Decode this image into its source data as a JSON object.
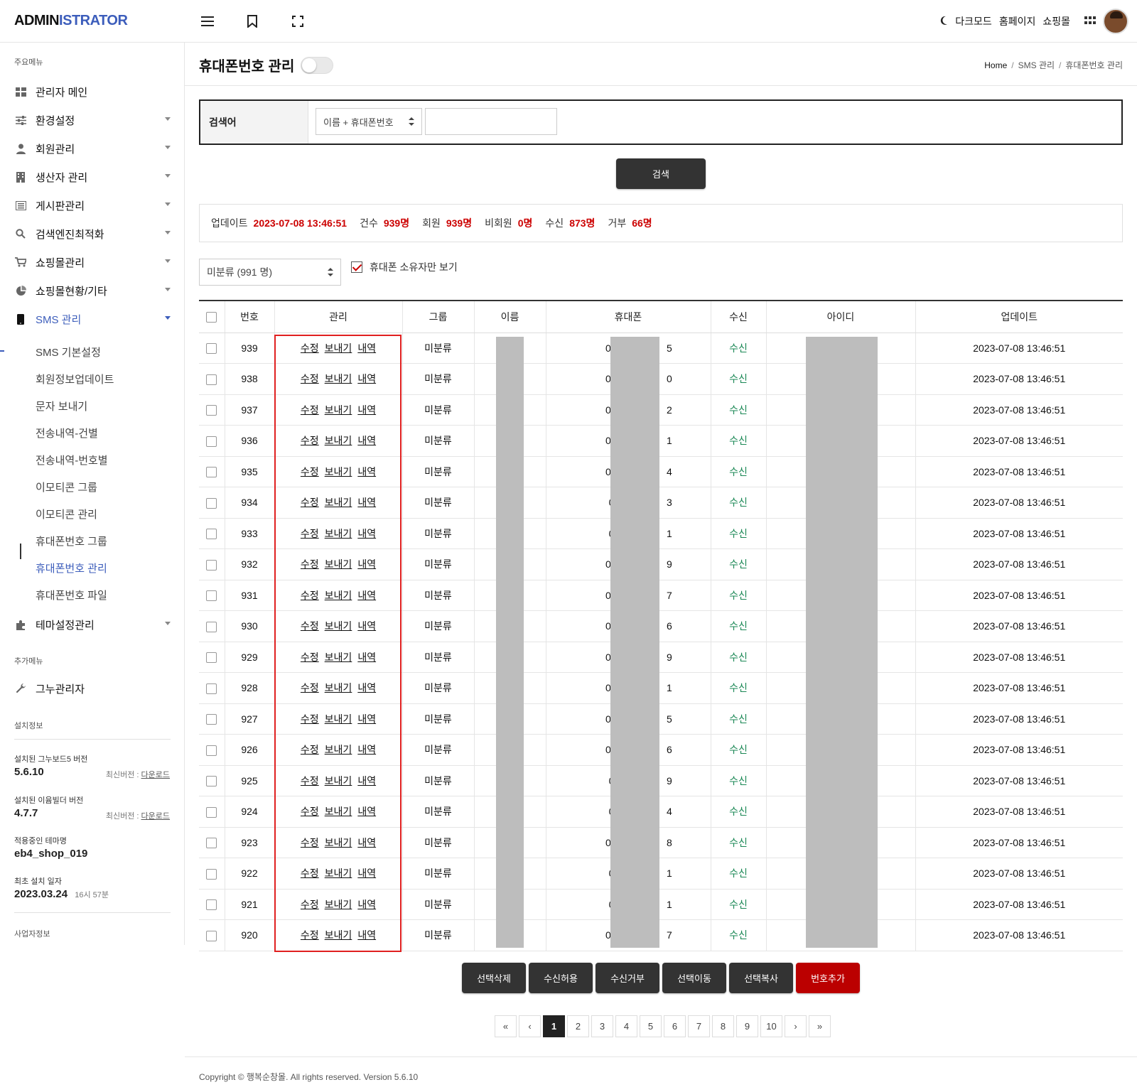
{
  "topbar": {
    "logo_a": "ADMIN",
    "logo_b": "ISTRATOR",
    "dark_mode": "다크모드",
    "homepage": "홈페이지",
    "shop": "쇼핑몰"
  },
  "sidebar": {
    "main_section": "주요메뉴",
    "items": [
      {
        "label": "관리자 메인",
        "icon": "dashboard-icon"
      },
      {
        "label": "환경설정",
        "icon": "sliders-icon"
      },
      {
        "label": "회원관리",
        "icon": "user-icon"
      },
      {
        "label": "생산자 관리",
        "icon": "building-icon"
      },
      {
        "label": "게시판관리",
        "icon": "list-icon"
      },
      {
        "label": "검색엔진최적화",
        "icon": "search-icon"
      },
      {
        "label": "쇼핑몰관리",
        "icon": "cart-icon"
      },
      {
        "label": "쇼핑몰현황/기타",
        "icon": "pie-chart-icon"
      },
      {
        "label": "SMS 관리",
        "icon": "phone-icon"
      },
      {
        "label": "테마설정관리",
        "icon": "puzzle-icon"
      }
    ],
    "sms_sub": [
      "SMS 기본설정",
      "회원정보업데이트",
      "문자 보내기",
      "전송내역-건별",
      "전송내역-번호별",
      "이모티콘 그룹",
      "이모티콘 관리",
      "휴대폰번호 그룹",
      "휴대폰번호 관리",
      "휴대폰번호 파일"
    ],
    "extra_section": "추가메뉴",
    "extra_item": "그누관리자",
    "install_section": "설치정보",
    "gnuboard_label": "설치된 그누보드5 버전",
    "gnuboard_version": "5.6.10",
    "latest_label": "최신버전 :",
    "download": "다운로드",
    "builder_label": "설치된 이윰빌더 버전",
    "builder_version": "4.7.7",
    "theme_label": "적용중인 테마명",
    "theme_name": "eb4_shop_019",
    "install_date_label": "최초 설치 일자",
    "install_date": "2023.03.24",
    "install_time": "16시 57분",
    "biz_section": "사업자정보"
  },
  "page": {
    "title": "휴대폰번호 관리",
    "breadcrumb": [
      "Home",
      "SMS 관리",
      "휴대폰번호 관리"
    ]
  },
  "search": {
    "label": "검색어",
    "select_value": "이름 + 휴대폰번호",
    "input_value": "",
    "button": "검색"
  },
  "stats": {
    "update_label": "업데이트",
    "update_value": "2023-07-08 13:46:51",
    "count_label": "건수",
    "count_value": "939명",
    "member_label": "회원",
    "member_value": "939명",
    "nonmember_label": "비회원",
    "nonmember_value": "0명",
    "receive_label": "수신",
    "receive_value": "873명",
    "reject_label": "거부",
    "reject_value": "66명"
  },
  "filter": {
    "group_select": "미분류 (991 명)",
    "owner_only": "휴대폰 소유자만 보기",
    "owner_only_checked": true
  },
  "table": {
    "headers": [
      "번호",
      "관리",
      "그룹",
      "이름",
      "휴대폰",
      "수신",
      "아이디",
      "업데이트"
    ],
    "actions": [
      "수정",
      "보내기",
      "내역"
    ],
    "rows": [
      {
        "no": "939",
        "group": "미분류",
        "phone_a": "010-",
        "phone_b": "5",
        "recv": "수신",
        "updated": "2023-07-08 13:46:51"
      },
      {
        "no": "938",
        "group": "미분류",
        "phone_a": "010-",
        "phone_b": "0",
        "recv": "수신",
        "updated": "2023-07-08 13:46:51"
      },
      {
        "no": "937",
        "group": "미분류",
        "phone_a": "010-",
        "phone_b": "2",
        "recv": "수신",
        "updated": "2023-07-08 13:46:51"
      },
      {
        "no": "936",
        "group": "미분류",
        "phone_a": "010-",
        "phone_b": "1",
        "recv": "수신",
        "updated": "2023-07-08 13:46:51"
      },
      {
        "no": "935",
        "group": "미분류",
        "phone_a": "010-",
        "phone_b": "4",
        "recv": "수신",
        "updated": "2023-07-08 13:46:51"
      },
      {
        "no": "934",
        "group": "미분류",
        "phone_a": "010",
        "phone_b": "3",
        "recv": "수신",
        "updated": "2023-07-08 13:46:51"
      },
      {
        "no": "933",
        "group": "미분류",
        "phone_a": "010",
        "phone_b": "1",
        "recv": "수신",
        "updated": "2023-07-08 13:46:51"
      },
      {
        "no": "932",
        "group": "미분류",
        "phone_a": "010-",
        "phone_b": "9",
        "recv": "수신",
        "updated": "2023-07-08 13:46:51"
      },
      {
        "no": "931",
        "group": "미분류",
        "phone_a": "010-",
        "phone_b": "7",
        "recv": "수신",
        "updated": "2023-07-08 13:46:51"
      },
      {
        "no": "930",
        "group": "미분류",
        "phone_a": "010-",
        "phone_b": "6",
        "recv": "수신",
        "updated": "2023-07-08 13:46:51"
      },
      {
        "no": "929",
        "group": "미분류",
        "phone_a": "010-",
        "phone_b": "9",
        "recv": "수신",
        "updated": "2023-07-08 13:46:51"
      },
      {
        "no": "928",
        "group": "미분류",
        "phone_a": "010-",
        "phone_b": "1",
        "recv": "수신",
        "updated": "2023-07-08 13:46:51"
      },
      {
        "no": "927",
        "group": "미분류",
        "phone_a": "010-",
        "phone_b": "5",
        "recv": "수신",
        "updated": "2023-07-08 13:46:51"
      },
      {
        "no": "926",
        "group": "미분류",
        "phone_a": "010-",
        "phone_b": "6",
        "recv": "수신",
        "updated": "2023-07-08 13:46:51"
      },
      {
        "no": "925",
        "group": "미분류",
        "phone_a": "010",
        "phone_b": "9",
        "recv": "수신",
        "updated": "2023-07-08 13:46:51"
      },
      {
        "no": "924",
        "group": "미분류",
        "phone_a": "010",
        "phone_b": "4",
        "recv": "수신",
        "updated": "2023-07-08 13:46:51"
      },
      {
        "no": "923",
        "group": "미분류",
        "phone_a": "010-",
        "phone_b": "8",
        "recv": "수신",
        "updated": "2023-07-08 13:46:51"
      },
      {
        "no": "922",
        "group": "미분류",
        "phone_a": "010",
        "phone_b": "1",
        "recv": "수신",
        "updated": "2023-07-08 13:46:51"
      },
      {
        "no": "921",
        "group": "미분류",
        "phone_a": "010",
        "phone_b": "1",
        "recv": "수신",
        "updated": "2023-07-08 13:46:51"
      },
      {
        "no": "920",
        "group": "미분류",
        "phone_a": "010-",
        "phone_b": "7",
        "recv": "수신",
        "updated": "2023-07-08 13:46:51"
      }
    ]
  },
  "bottom_buttons": [
    "선택삭제",
    "수신허용",
    "수신거부",
    "선택이동",
    "선택복사",
    "번호추가"
  ],
  "pagination": {
    "pages": [
      "1",
      "2",
      "3",
      "4",
      "5",
      "6",
      "7",
      "8",
      "9",
      "10"
    ],
    "current": "1",
    "first": "«",
    "prev": "‹",
    "next": "›",
    "last": "»"
  },
  "footer": "Copyright © 행복순창몰. All rights reserved. Version 5.6.10",
  "colors": {
    "accent": "#3c5dbb",
    "stat_value": "#cc0000",
    "receive": "#198754",
    "add_button": "#bb0000",
    "highlight_frame": "#e02020"
  }
}
